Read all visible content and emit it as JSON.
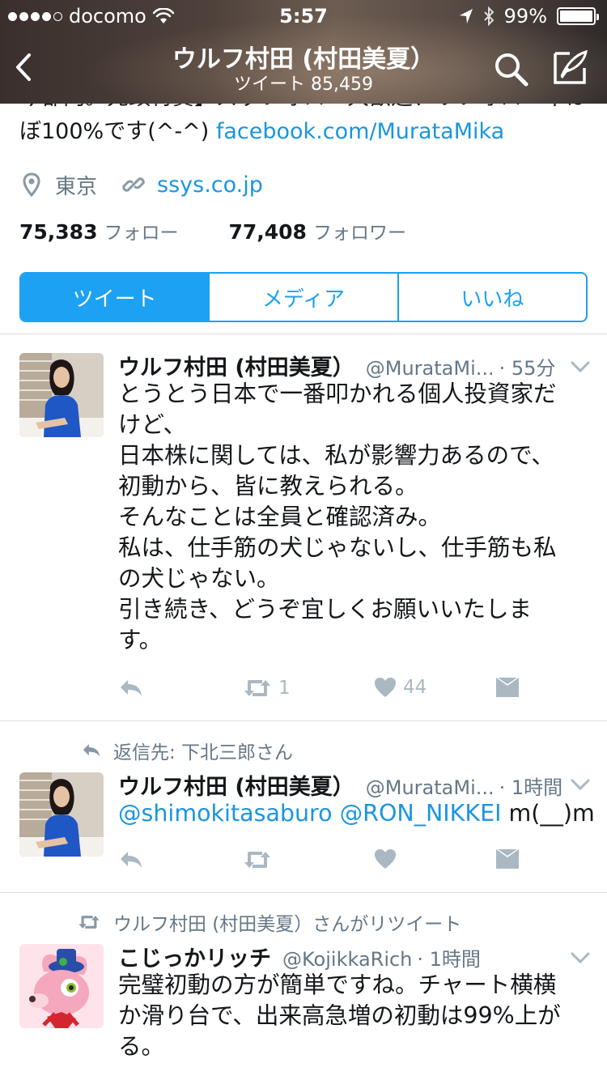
{
  "status_bar": {
    "carrier": "docomo",
    "time": "5:57",
    "battery": "99%",
    "battery_level": 0.99
  },
  "nav": {
    "title": "ウルフ村田 (村田美夏）",
    "tweet_count": "ツイート 85,459"
  },
  "profile": {
    "bio_prev_line": "今都内。先頭特賞】ズッフォロー大歓迎、リフォロー率ほ",
    "bio_line_text": "ぼ100%です(^-^) ",
    "bio_link": "facebook.com/MurataMika",
    "location": "東京",
    "website": "ssys.co.jp",
    "following_count": "75,383",
    "following_label": "フォロー",
    "followers_count": "77,408",
    "followers_label": "フォロワー"
  },
  "tabs": [
    {
      "label": "ツイート",
      "active": true
    },
    {
      "label": "メディア",
      "active": false
    },
    {
      "label": "いいね",
      "active": false
    }
  ],
  "tweets": [
    {
      "name": "ウルフ村田 (村田美夏）",
      "handle": "@MurataMi...",
      "time": "· 55分",
      "lines": [
        "とうとう日本で一番叩かれる個人投資家だ",
        "けど、",
        "日本株に関しては、私が影響力あるので、",
        "初動から、皆に教えられる。",
        "そんなことは全員と確認済み。",
        "私は、仕手筋の犬じゃないし、仕手筋も私",
        "の犬じゃない。",
        "引き続き、どうぞ宜しくお願いいたしま",
        "す。"
      ],
      "retweets": "1",
      "likes": "44"
    },
    {
      "reply_context": "返信先: 下北三郎さん",
      "name": "ウルフ村田 (村田美夏）",
      "handle": "@MurataMi...",
      "time": "· 1時間",
      "mention1": "@shimokitasaburo",
      "mention2": "@RON_NIKKEI",
      "text_tail": "m(__)m"
    },
    {
      "retweet_context": "ウルフ村田 (村田美夏）さんがリツイート",
      "name": "こじっかリッチ",
      "handle": "@KojikkaRich",
      "time": "· 1時間",
      "lines": [
        "完璧初動の方が簡単ですね。チャート横横",
        "か滑り台で、出来高急増の初動は99%上が",
        "る。"
      ]
    }
  ],
  "colors": {
    "accent": "#1da1f2",
    "link": "#1b95e0",
    "secondary_text": "#657786",
    "action_icons": "#aab8c2"
  },
  "icons": [
    "signal-dots",
    "wifi-icon",
    "location-arrow-icon",
    "bluetooth-icon",
    "battery-icon",
    "back-chevron-icon",
    "search-icon",
    "compose-icon",
    "location-pin-icon",
    "link-icon",
    "chevron-down-icon",
    "reply-icon",
    "retweet-icon",
    "heart-icon",
    "direct-message-icon"
  ]
}
